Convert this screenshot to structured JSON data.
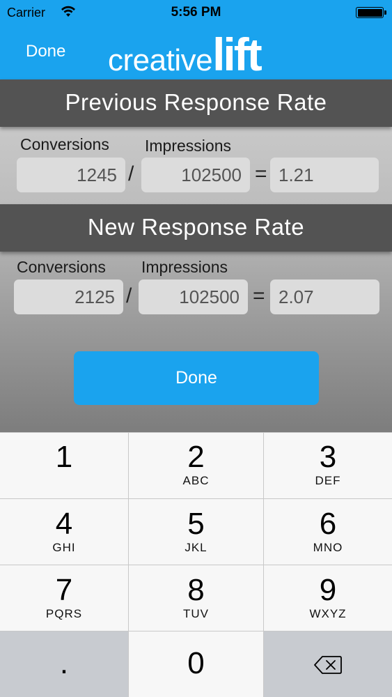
{
  "status_bar": {
    "carrier": "Carrier",
    "time": "5:56 PM"
  },
  "nav_bar": {
    "done_label": "Done",
    "logo_part1": "creative",
    "logo_part2": "lift"
  },
  "previous": {
    "title": "Previous Response Rate",
    "conversions_label": "Conversions",
    "impressions_label": "Impressions",
    "conversions_value": "1245",
    "impressions_value": "102500",
    "result_value": "1.21"
  },
  "new": {
    "title": "New Response Rate",
    "conversions_label": "Conversions",
    "impressions_label": "Impressions",
    "conversions_value": "2125",
    "impressions_value": "102500",
    "result_value": "2.07"
  },
  "operators": {
    "divide": "/",
    "equals": "="
  },
  "done_button_label": "Done",
  "keyboard": {
    "keys": [
      {
        "num": "1",
        "letters": ""
      },
      {
        "num": "2",
        "letters": "ABC"
      },
      {
        "num": "3",
        "letters": "DEF"
      },
      {
        "num": "4",
        "letters": "GHI"
      },
      {
        "num": "5",
        "letters": "JKL"
      },
      {
        "num": "6",
        "letters": "MNO"
      },
      {
        "num": "7",
        "letters": "PQRS"
      },
      {
        "num": "8",
        "letters": "TUV"
      },
      {
        "num": "9",
        "letters": "WXYZ"
      }
    ],
    "decimal": ".",
    "zero": "0",
    "delete_icon": "backspace-icon"
  },
  "colors": {
    "accent": "#1aa3ee",
    "header": "#535353",
    "field": "#dcdcdc"
  }
}
